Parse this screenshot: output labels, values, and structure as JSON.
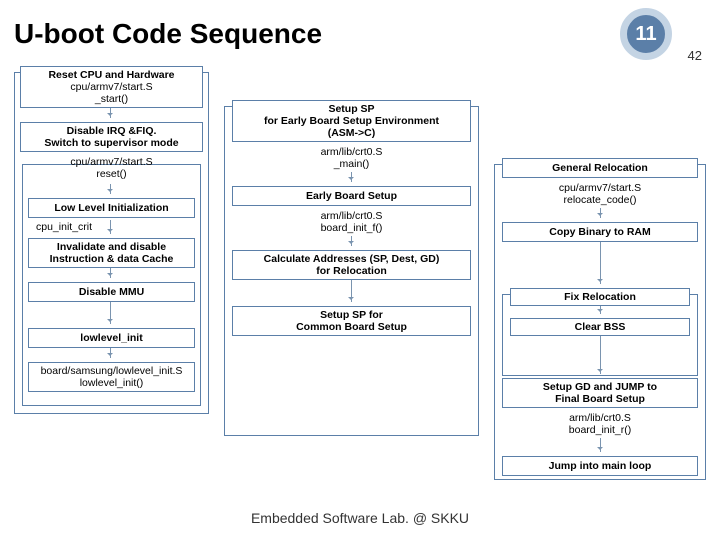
{
  "header": {
    "title": "U-boot Code Sequence",
    "page_number": "11",
    "page_total": "42"
  },
  "col1": {
    "reset_title": "Reset CPU and Hardware",
    "reset_path": "cpu/armv7/start.S",
    "reset_fn": "_start()",
    "disable_irq_title": "Disable IRQ &FIQ.\nSwitch to supervisor mode",
    "disable_irq_path": "cpu/armv7/start.S",
    "disable_irq_fn": "reset()",
    "lli_title": "Low Level Initialization",
    "cpu_init_crit": "cpu_init_crit",
    "invalidate": "Invalidate and disable\nInstruction & data Cache",
    "disable_mmu": "Disable MMU",
    "lowlevel_init": "lowlevel_init",
    "lowlevel_init_path": "board/samsung/lowlevel_init.S",
    "lowlevel_init_fn": "lowlevel_init()"
  },
  "col2": {
    "setup_sp_title": "Setup SP\nfor Early Board Setup Environment\n(ASM->C)",
    "main_path": "arm/lib/crt0.S",
    "main_fn": "_main()",
    "early_board": "Early Board Setup",
    "early_board_path": "arm/lib/crt0.S",
    "early_board_fn": "board_init_f()",
    "calc_addr": "Calculate Addresses (SP, Dest, GD)\nfor Relocation",
    "setup_sp_common": "Setup SP for\nCommon Board Setup"
  },
  "col3": {
    "gen_reloc": "General Relocation",
    "gen_reloc_path": "cpu/armv7/start.S",
    "gen_reloc_fn": "relocate_code()",
    "copy_ram": "Copy Binary to RAM",
    "fix_reloc": "Fix Relocation",
    "clear_bss": "Clear BSS",
    "setup_gd": "Setup GD and JUMP to\nFinal Board Setup",
    "setup_gd_path": "arm/lib/crt0.S",
    "setup_gd_fn": "board_init_r()",
    "jump_main": "Jump into main loop"
  },
  "footer": {
    "text": "Embedded Software Lab. @ SKKU"
  }
}
